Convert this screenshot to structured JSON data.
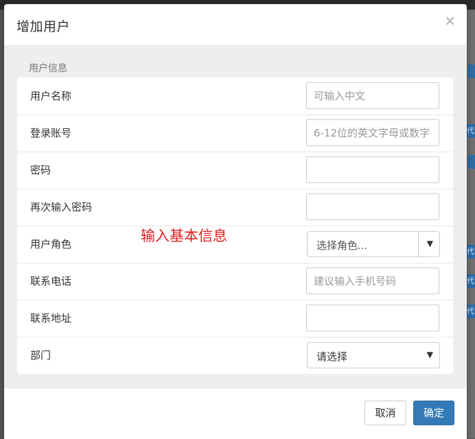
{
  "dialog": {
    "title": "增加用户",
    "close_glyph": "×",
    "section_label": "用户信息",
    "annotation": "输入基本信息"
  },
  "form": {
    "rows": [
      {
        "label": "用户名称",
        "placeholder": "可输入中文",
        "type": "text"
      },
      {
        "label": "登录账号",
        "placeholder": "6-12位的英文字母或数字",
        "type": "text"
      },
      {
        "label": "密码",
        "placeholder": "",
        "type": "password"
      },
      {
        "label": "再次输入密码",
        "placeholder": "",
        "type": "password"
      },
      {
        "label": "用户角色",
        "selected": "选择角色...",
        "type": "select-with-addon"
      },
      {
        "label": "联系电话",
        "placeholder": "建议输入手机号码",
        "type": "text"
      },
      {
        "label": "联系地址",
        "placeholder": "",
        "type": "text"
      },
      {
        "label": "部门",
        "selected": "请选择",
        "type": "select"
      }
    ]
  },
  "footer": {
    "cancel_label": "取消",
    "confirm_label": "确定"
  },
  "background": {
    "peek_text": "代"
  },
  "colors": {
    "primary": "#337ab7",
    "annotation": "#e02020",
    "body_bg": "#eeeeee"
  }
}
